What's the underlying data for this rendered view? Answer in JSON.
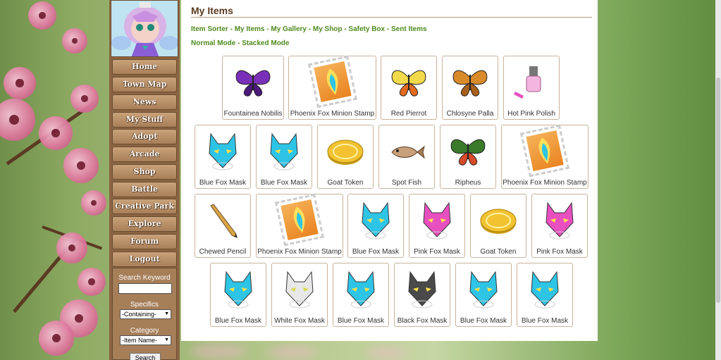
{
  "page": {
    "title": "My Items"
  },
  "links_row1": [
    "Item Sorter",
    "My Items",
    "My Gallery",
    "My Shop",
    "Safety Box",
    "Sent Items"
  ],
  "links_row2": [
    "Normal Mode",
    "Stacked Mode"
  ],
  "nav": [
    "Home",
    "Town Map",
    "News",
    "My Stuff",
    "Adopt",
    "Arcade",
    "Shop",
    "Battle",
    "Creative Park",
    "Explore",
    "Forum",
    "Logout"
  ],
  "search": {
    "keyword_label": "Search Keyword",
    "keyword_value": "",
    "specifics_label": "Specifics",
    "specifics_value": "-Containing-",
    "category_label": "Category",
    "category_value": "-Item Name-",
    "button": "Search"
  },
  "items": [
    {
      "name": "Fountainea Nobilis",
      "icon": "purple-butterfly-icon"
    },
    {
      "name": "Phoenix Fox Minion Stamp",
      "icon": "stamp-icon"
    },
    {
      "name": "Red Pierrot",
      "icon": "yellow-butterfly-icon"
    },
    {
      "name": "Chlosyne Palla",
      "icon": "orange-butterfly-icon"
    },
    {
      "name": "Hot Pink Polish",
      "icon": "nail-polish-icon"
    },
    {
      "name": "Blue Fox Mask",
      "icon": "blue-fox-mask-icon"
    },
    {
      "name": "Blue Fox Mask",
      "icon": "blue-fox-mask-icon"
    },
    {
      "name": "Goat Token",
      "icon": "gold-token-icon"
    },
    {
      "name": "Spot Fish",
      "icon": "fish-icon"
    },
    {
      "name": "Ripheus",
      "icon": "green-butterfly-icon"
    },
    {
      "name": "Phoenix Fox Minion Stamp",
      "icon": "stamp-icon"
    },
    {
      "name": "Chewed Pencil",
      "icon": "pencil-icon"
    },
    {
      "name": "Phoenix Fox Minion Stamp",
      "icon": "stamp-icon"
    },
    {
      "name": "Blue Fox Mask",
      "icon": "blue-fox-mask-icon"
    },
    {
      "name": "Pink Fox Mask",
      "icon": "pink-fox-mask-icon"
    },
    {
      "name": "Goat Token",
      "icon": "gold-token-icon"
    },
    {
      "name": "Pink Fox Mask",
      "icon": "pink-fox-mask-icon"
    },
    {
      "name": "Blue Fox Mask",
      "icon": "blue-fox-mask-icon"
    },
    {
      "name": "White Fox Mask",
      "icon": "white-fox-mask-icon"
    },
    {
      "name": "Blue Fox Mask",
      "icon": "blue-fox-mask-icon"
    },
    {
      "name": "Black Fox Mask",
      "icon": "black-fox-mask-icon"
    },
    {
      "name": "Blue Fox Mask",
      "icon": "blue-fox-mask-icon"
    },
    {
      "name": "Blue Fox Mask",
      "icon": "blue-fox-mask-icon"
    }
  ],
  "colors": {
    "link": "#4f8a1f",
    "title": "#5b3b20",
    "sidebar": "#8a6442"
  }
}
